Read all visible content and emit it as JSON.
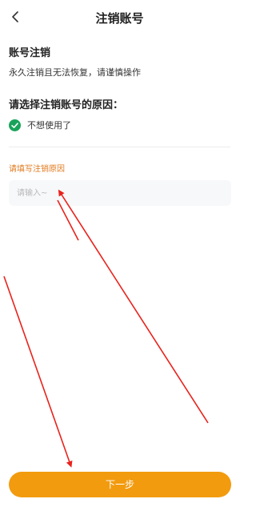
{
  "header": {
    "title": "注销账号",
    "back_icon": "chevron-left-icon"
  },
  "section": {
    "title": "账号注销",
    "description": "永久注销且无法恢复，请谨慎操作"
  },
  "reason": {
    "title": "请选择注销账号的原因：",
    "options": [
      {
        "label": "不想使用了",
        "checked": true
      }
    ]
  },
  "input": {
    "label": "请填写注销原因",
    "placeholder": "请输入~",
    "value": ""
  },
  "footer": {
    "next_label": "下一步"
  },
  "colors": {
    "accent": "#f29b0f",
    "check": "#19a35a",
    "label_orange": "#e07a1f",
    "arrow": "#e8231c"
  }
}
